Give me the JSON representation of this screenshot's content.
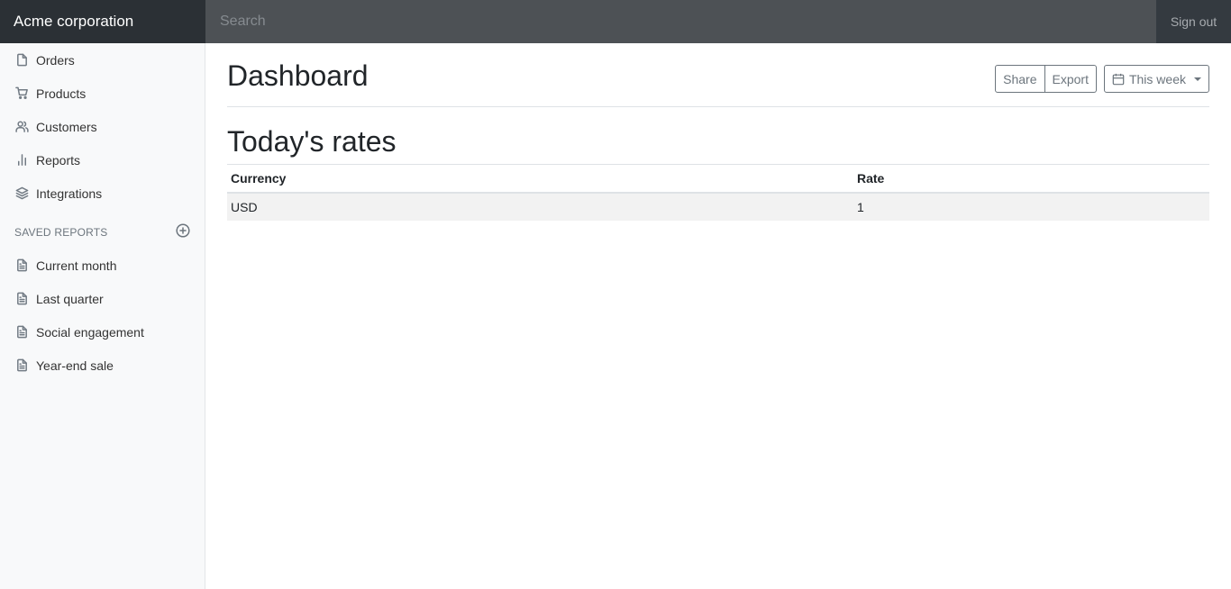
{
  "navbar": {
    "brand": "Acme corporation",
    "search_placeholder": "Search",
    "signout": "Sign out"
  },
  "sidebar": {
    "items": [
      {
        "label": "Orders",
        "icon": "file-icon"
      },
      {
        "label": "Products",
        "icon": "cart-icon"
      },
      {
        "label": "Customers",
        "icon": "users-icon"
      },
      {
        "label": "Reports",
        "icon": "bar-chart-icon"
      },
      {
        "label": "Integrations",
        "icon": "layers-icon"
      }
    ],
    "saved_reports_title": "SAVED REPORTS",
    "saved_reports": [
      {
        "label": "Current month"
      },
      {
        "label": "Last quarter"
      },
      {
        "label": "Social engagement"
      },
      {
        "label": "Year-end sale"
      }
    ]
  },
  "main": {
    "title": "Dashboard",
    "toolbar": {
      "share": "Share",
      "export": "Export",
      "period": "This week"
    },
    "section_title": "Today's rates",
    "table": {
      "headers": [
        "Currency",
        "Rate"
      ],
      "rows": [
        [
          "USD",
          "1"
        ]
      ]
    }
  }
}
